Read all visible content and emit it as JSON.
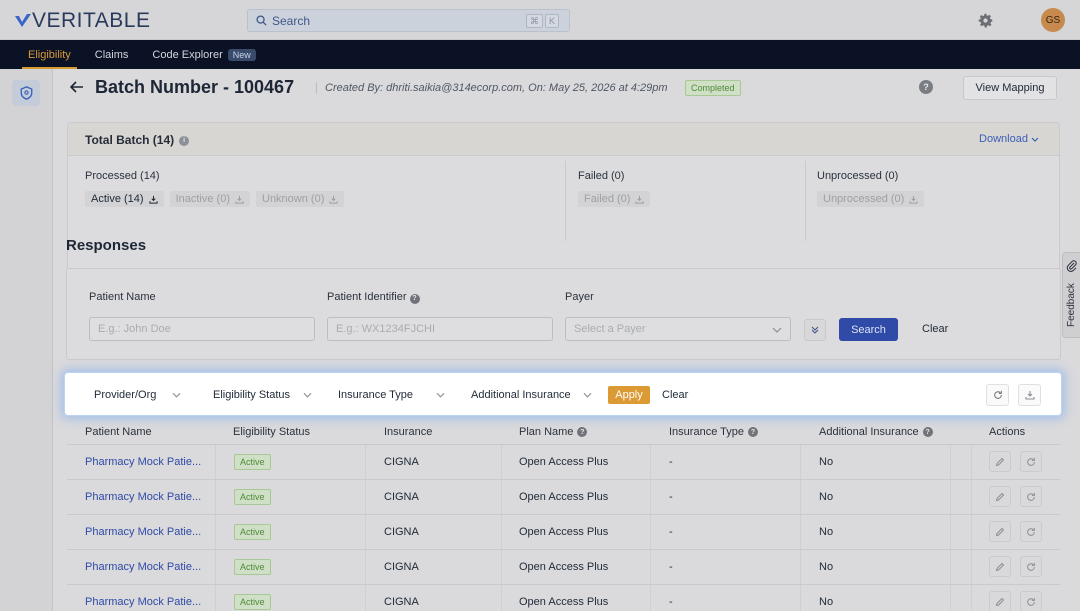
{
  "app": {
    "logo_text": "VERITABLE",
    "search_placeholder": "Search",
    "search_shortcut": [
      "⌘",
      "K"
    ],
    "user_initials": "GS"
  },
  "nav": {
    "items": [
      {
        "label": "Eligibility",
        "active": true
      },
      {
        "label": "Claims",
        "active": false
      },
      {
        "label": "Code Explorer",
        "active": false,
        "badge": "New"
      }
    ]
  },
  "header": {
    "title": "Batch Number - 100467",
    "created": "Created By: dhriti.saikia@314ecorp.com, On: May 25, 2026 at 4:29pm",
    "status": "Completed",
    "view_mapping": "View Mapping"
  },
  "batch": {
    "title": "Total Batch (14)",
    "download": "Download",
    "processed": {
      "label": "Processed (14)",
      "chips": [
        {
          "label": "Active (14)",
          "enabled": true
        },
        {
          "label": "Inactive (0)",
          "enabled": false
        },
        {
          "label": "Unknown (0)",
          "enabled": false
        }
      ]
    },
    "failed": {
      "label": "Failed (0)",
      "chips": [
        {
          "label": "Failed (0)",
          "enabled": false
        }
      ]
    },
    "unprocessed": {
      "label": "Unprocessed (0)",
      "chips": [
        {
          "label": "Unprocessed (0)",
          "enabled": false
        }
      ]
    }
  },
  "responses": {
    "title": "Responses",
    "fields": {
      "patient_name": {
        "label": "Patient Name",
        "placeholder": "E.g.: John Doe"
      },
      "patient_identifier": {
        "label": "Patient Identifier",
        "placeholder": "E.g.: WX1234FJCHI"
      },
      "payer": {
        "label": "Payer",
        "placeholder": "Select a Payer"
      }
    },
    "search_button": "Search",
    "clear_button": "Clear"
  },
  "filter_bar": {
    "filters": [
      "Provider/Org",
      "Eligibility Status",
      "Insurance Type",
      "Additional Insurance"
    ],
    "apply": "Apply",
    "clear": "Clear"
  },
  "table": {
    "headers": [
      "Patient Name",
      "Eligibility Status",
      "Insurance",
      "Plan Name",
      "Insurance Type",
      "Additional Insurance",
      "Actions"
    ],
    "rows": [
      {
        "patient": "Pharmacy Mock Patie...",
        "status": "Active",
        "insurance": "CIGNA",
        "plan": "Open Access Plus",
        "type": "-",
        "additional": "No"
      },
      {
        "patient": "Pharmacy Mock Patie...",
        "status": "Active",
        "insurance": "CIGNA",
        "plan": "Open Access Plus",
        "type": "-",
        "additional": "No"
      },
      {
        "patient": "Pharmacy Mock Patie...",
        "status": "Active",
        "insurance": "CIGNA",
        "plan": "Open Access Plus",
        "type": "-",
        "additional": "No"
      },
      {
        "patient": "Pharmacy Mock Patie...",
        "status": "Active",
        "insurance": "CIGNA",
        "plan": "Open Access Plus",
        "type": "-",
        "additional": "No"
      },
      {
        "patient": "Pharmacy Mock Patie...",
        "status": "Active",
        "insurance": "CIGNA",
        "plan": "Open Access Plus",
        "type": "-",
        "additional": "No"
      }
    ]
  },
  "feedback": "Feedback",
  "colors": {
    "nav_bg": "#0c1226",
    "accent": "#d79a35",
    "primary": "#2f4aa7",
    "success": "#4f8a3a"
  }
}
